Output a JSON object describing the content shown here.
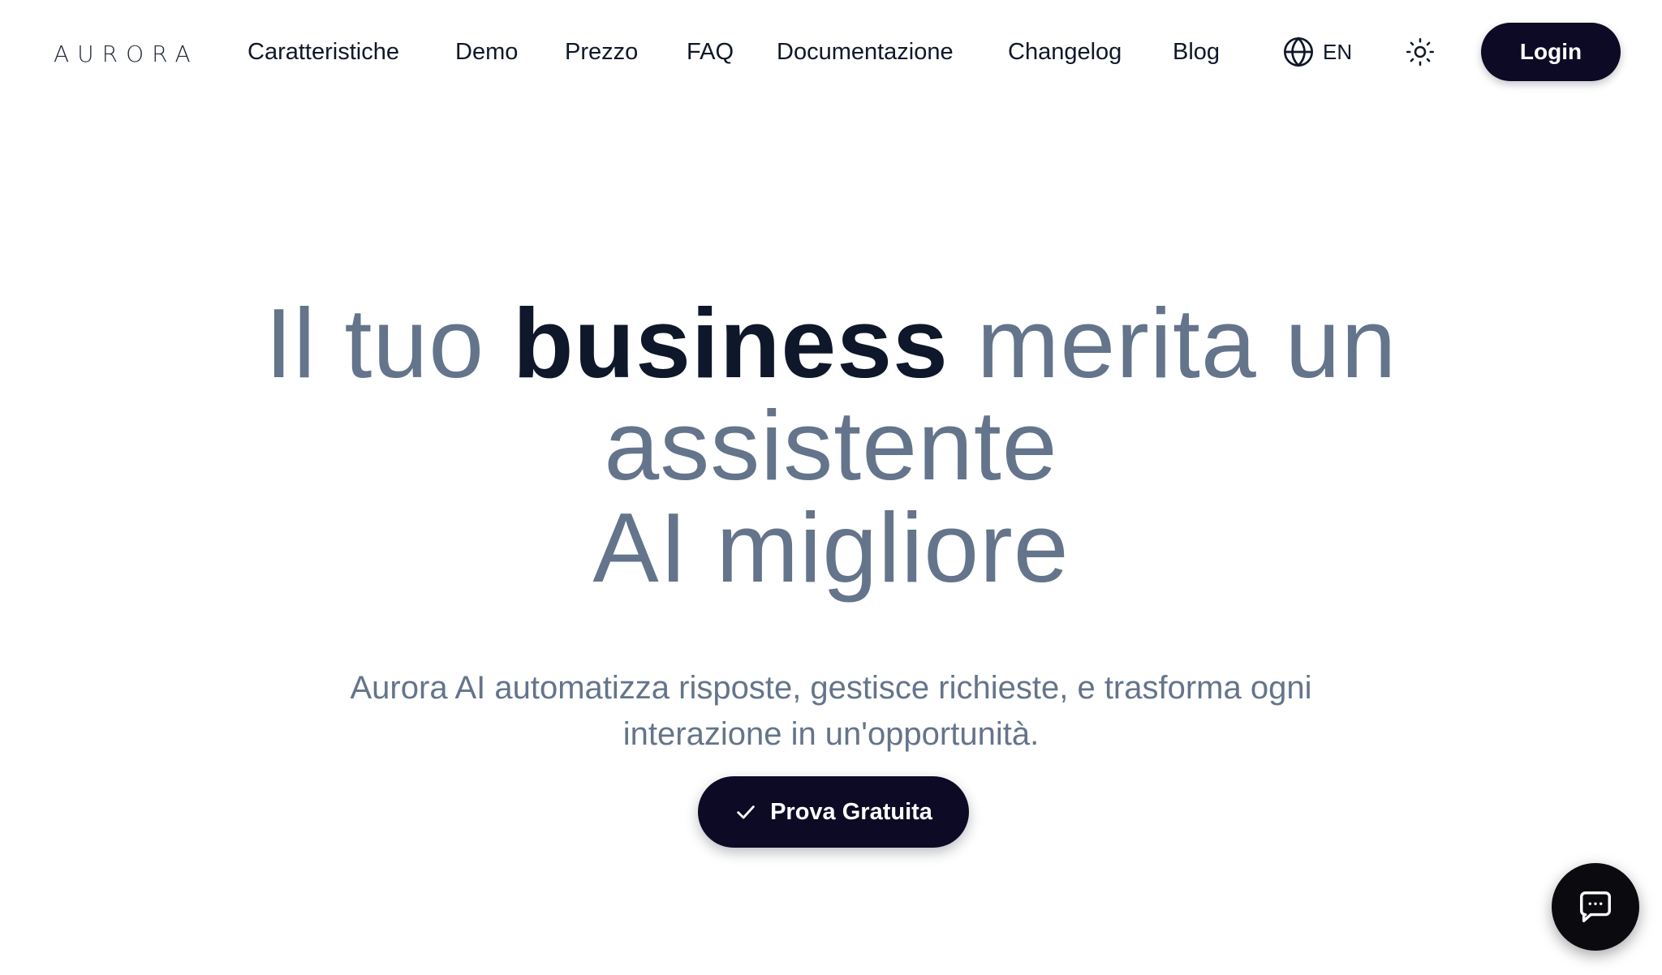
{
  "brand": {
    "name": "AURORA",
    "accent_gradient": [
      "#34d399",
      "#22d3ee",
      "#a78bfa"
    ]
  },
  "nav": {
    "links": [
      {
        "label": "Caratteristiche"
      },
      {
        "label": "Demo"
      },
      {
        "label": "Prezzo"
      },
      {
        "label": "FAQ"
      },
      {
        "label": "Documentazione"
      },
      {
        "label": "Changelog"
      },
      {
        "label": "Blog"
      }
    ],
    "language": {
      "icon": "globe-icon",
      "label": "EN"
    },
    "theme_toggle": {
      "icon": "sun-icon"
    },
    "login_label": "Login"
  },
  "hero": {
    "title_part1": "Il tuo ",
    "title_strong": "business",
    "title_part2": " merita un",
    "title_line2": "assistente",
    "title_line3": "AI migliore",
    "subtitle_line1": "Aurora AI automatizza risposte, gestisce richieste, e trasforma ogni",
    "subtitle_line2": "interazione in un'opportunità.",
    "cta_label": "Prova Gratuita",
    "cta_icon": "check-icon"
  },
  "chat_widget": {
    "icon": "chat-icon"
  },
  "colors": {
    "primary_dark": "#0c0a24",
    "muted_text": "#64748b",
    "heading_strong": "#0f172a"
  }
}
